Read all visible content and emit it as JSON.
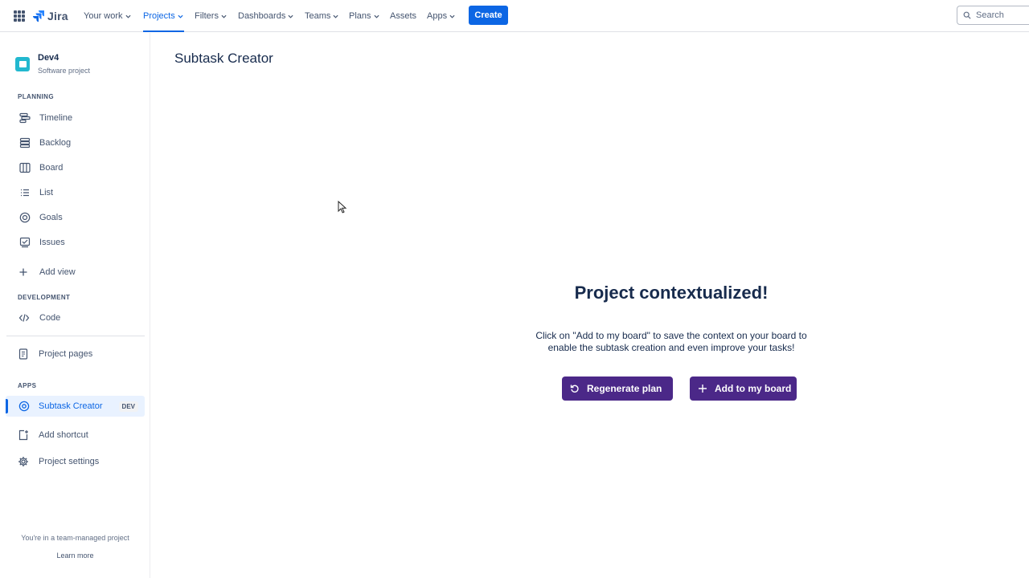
{
  "topnav": {
    "logo_text": "Jira",
    "items": [
      "Your work",
      "Projects",
      "Filters",
      "Dashboards",
      "Teams",
      "Plans",
      "Assets",
      "Apps"
    ],
    "active_item": "Projects",
    "create_label": "Create",
    "search_placeholder": "Search",
    "accent_color": "#0c66e4"
  },
  "sidebar": {
    "project_name": "Dev4",
    "project_type": "Software project",
    "planning_heading": "PLANNING",
    "planning_items": [
      {
        "label": "Timeline",
        "icon": "timeline-icon"
      },
      {
        "label": "Backlog",
        "icon": "backlog-icon"
      },
      {
        "label": "Board",
        "icon": "board-icon"
      },
      {
        "label": "List",
        "icon": "list-icon"
      },
      {
        "label": "Goals",
        "icon": "goals-icon"
      },
      {
        "label": "Issues",
        "icon": "issues-icon"
      }
    ],
    "add_view_label": "Add view",
    "development_heading": "DEVELOPMENT",
    "code_label": "Code",
    "project_pages_label": "Project pages",
    "apps_heading": "APPS",
    "app_item": {
      "label": "Subtask Creator",
      "badge": "DEV"
    },
    "add_shortcut_label": "Add shortcut",
    "project_settings_label": "Project settings",
    "footer_text": "You're in a team-managed project",
    "learn_more_label": "Learn more"
  },
  "main": {
    "page_title": "Subtask Creator",
    "context_title": "Project contextualized!",
    "context_desc_line1": "Click on \"Add to my board\" to save the context on your board to",
    "context_desc_line2": "enable the subtask creation and even improve your tasks!",
    "regenerate_label": "Regenerate plan",
    "add_board_label": "Add to my board",
    "button_color": "#4b2888"
  }
}
